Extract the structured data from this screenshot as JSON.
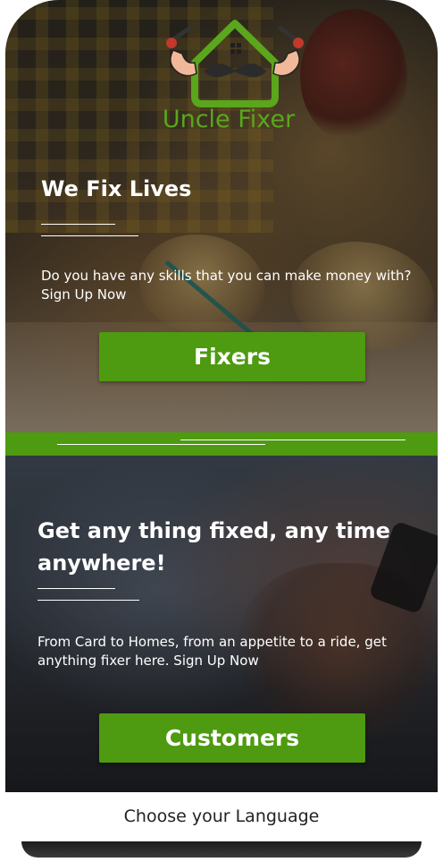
{
  "brand": {
    "name": "Uncle Fixer",
    "color": "#5aa61c"
  },
  "fixers_section": {
    "heading": "We Fix Lives",
    "description": "Do you have any skills that you can make money with? Sign Up Now",
    "button_label": "Fixers"
  },
  "customers_section": {
    "heading": "Get any thing fixed, any time anywhere!",
    "description": "From Card to Homes, from an appetite to a ride, get anything fixer here. Sign Up Now",
    "button_label": "Customers"
  },
  "language": {
    "label": "Choose your Language"
  },
  "colors": {
    "accent_green": "#4e9a10",
    "logo_green": "#5aa61c",
    "text_white": "#ffffff"
  }
}
